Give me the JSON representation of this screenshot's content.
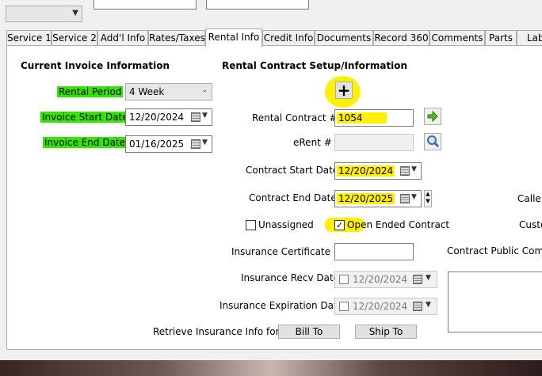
{
  "tabs": [
    "Service 1",
    "Service 2",
    "Add'l Info",
    "Rates/Taxes",
    "Rental Info",
    "Credit Info",
    "Documents",
    "Record 360",
    "Comments",
    "Parts",
    "Lab"
  ],
  "active_tab": "Rental Info",
  "left": {
    "header": "Current Invoice Information",
    "rental_period_label": "Rental Period",
    "rental_period_value": "4 Week",
    "invoice_start_label": "Invoice Start Date",
    "invoice_start_value": "12/20/2024",
    "invoice_end_label": "Invoice End Date",
    "invoice_end_value": "01/16/2025"
  },
  "contract": {
    "header": "Rental Contract Setup/Information",
    "contract_no_label": "Rental Contract #",
    "contract_no_value": "1054",
    "erent_label": "eRent #",
    "erent_value": "",
    "start_label": "Contract Start Date",
    "start_value": "12/20/2024",
    "end_label": "Contract End Date",
    "end_value": "12/20/2025",
    "unassigned_label": "Unassigned",
    "unassigned_checked": false,
    "open_ended_label": "Open Ended Contract",
    "open_ended_checked": true,
    "ins_cert_label": "Insurance Certificate #",
    "ins_cert_value": "",
    "ins_recv_label": "Insurance Recv Date",
    "ins_recv_value": "12/20/2024",
    "ins_exp_label": "Insurance Expiration Date",
    "ins_exp_value": "12/20/2024",
    "retrieve_label": "Retrieve Insurance Info for:",
    "bill_to_label": "Bill To",
    "ship_to_label": "Ship To"
  },
  "right": {
    "called_label": "Calle",
    "custo_label": "Custo",
    "public_comments_label": "Contract Public Comm"
  },
  "icons": {
    "add": "plus-icon",
    "go": "green-arrow-icon",
    "search": "magnifier-icon",
    "calendar": "calendar-icon"
  }
}
